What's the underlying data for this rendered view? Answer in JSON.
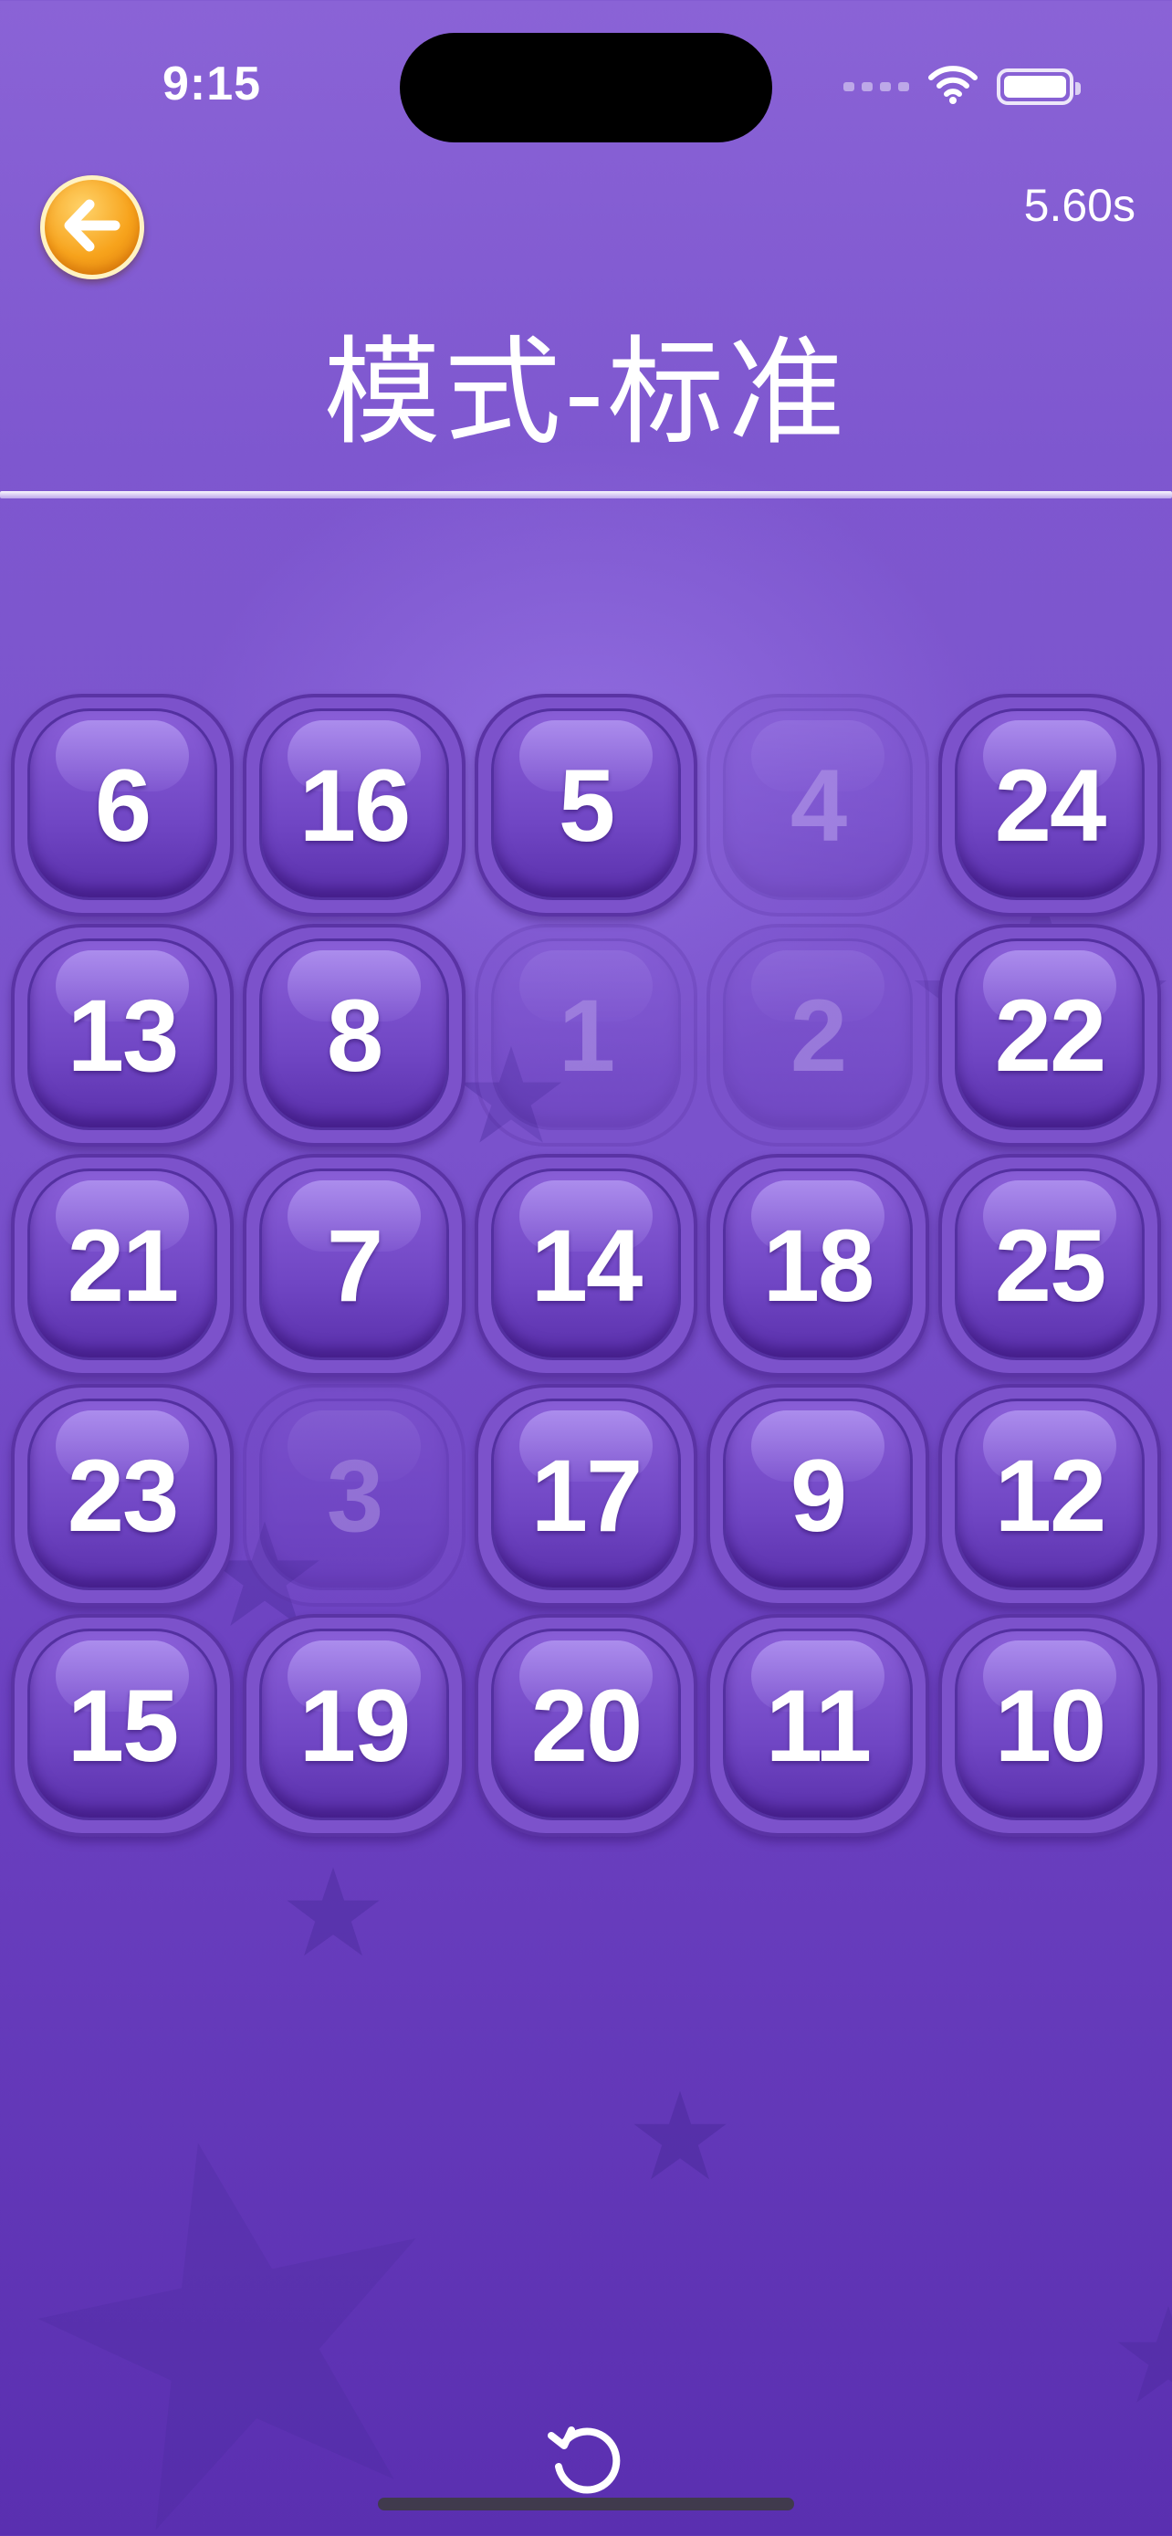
{
  "status_bar": {
    "time": "9:15"
  },
  "header": {
    "back_icon": "back-arrow-icon",
    "timer": "5.60s",
    "title": "模式-标准"
  },
  "board": {
    "tiles": [
      {
        "number": "6",
        "done": false
      },
      {
        "number": "16",
        "done": false
      },
      {
        "number": "5",
        "done": false
      },
      {
        "number": "4",
        "done": true
      },
      {
        "number": "24",
        "done": false
      },
      {
        "number": "13",
        "done": false
      },
      {
        "number": "8",
        "done": false
      },
      {
        "number": "1",
        "done": true
      },
      {
        "number": "2",
        "done": true
      },
      {
        "number": "22",
        "done": false
      },
      {
        "number": "21",
        "done": false
      },
      {
        "number": "7",
        "done": false
      },
      {
        "number": "14",
        "done": false
      },
      {
        "number": "18",
        "done": false
      },
      {
        "number": "25",
        "done": false
      },
      {
        "number": "23",
        "done": false
      },
      {
        "number": "3",
        "done": true
      },
      {
        "number": "17",
        "done": false
      },
      {
        "number": "9",
        "done": false
      },
      {
        "number": "12",
        "done": false
      },
      {
        "number": "15",
        "done": false
      },
      {
        "number": "19",
        "done": false
      },
      {
        "number": "20",
        "done": false
      },
      {
        "number": "11",
        "done": false
      },
      {
        "number": "10",
        "done": false
      }
    ]
  },
  "footer": {
    "reset_icon": "restart-icon"
  },
  "colors": {
    "background_top": "#8a63d6",
    "background_bottom": "#5a2fb0",
    "tile": "#7c52cb",
    "back_button": "#f7a31c"
  }
}
